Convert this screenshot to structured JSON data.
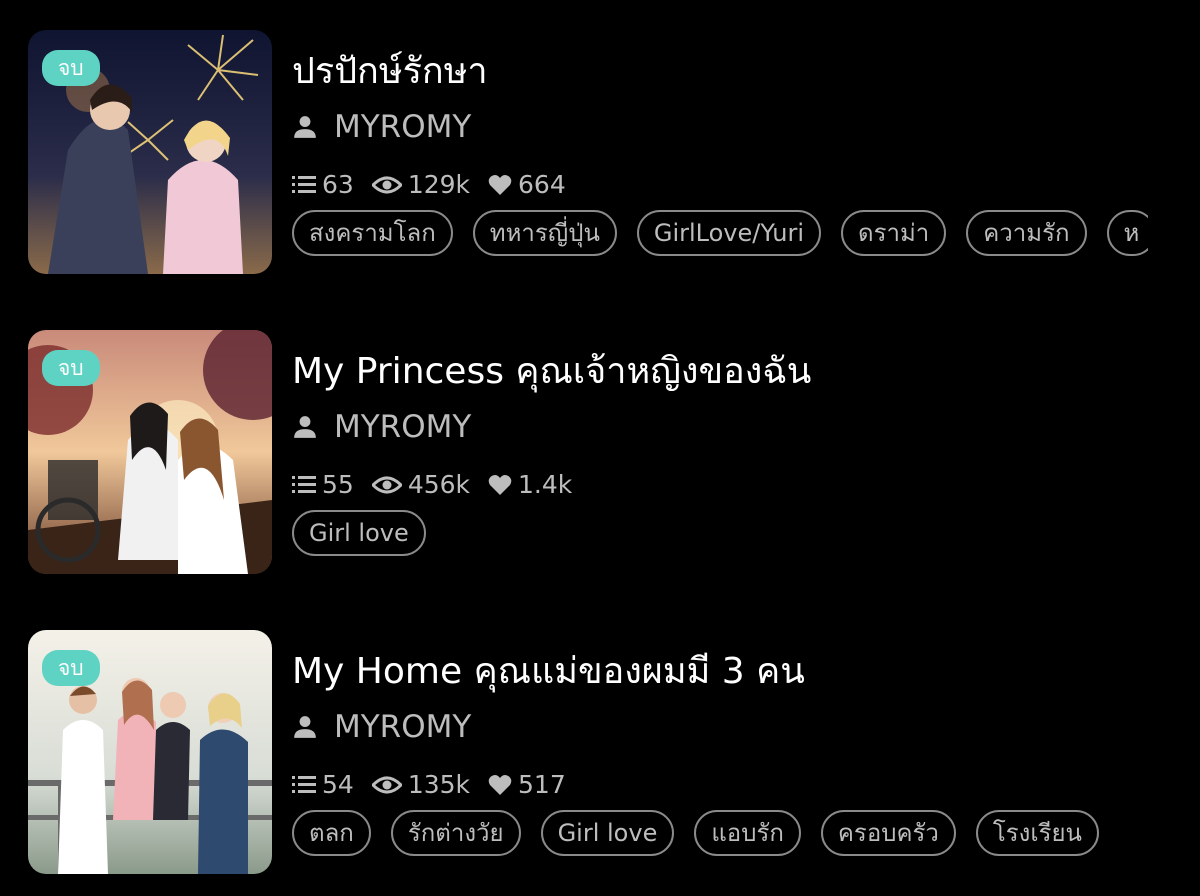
{
  "stories": [
    {
      "badge": "จบ",
      "title": "ปรปักษ์รักษา",
      "author": "MYROMY",
      "chapters": "63",
      "views": "129k",
      "likes": "664",
      "tags": [
        "สงครามโลก",
        "ทหารญี่ปุ่น",
        "GirlLove/Yuri",
        "ดราม่า",
        "ความรัก",
        "ห"
      ]
    },
    {
      "badge": "จบ",
      "title": "My Princess คุณเจ้าหญิงของฉัน",
      "author": "MYROMY",
      "chapters": "55",
      "views": "456k",
      "likes": "1.4k",
      "tags": [
        "Girl love"
      ]
    },
    {
      "badge": "จบ",
      "title": "My Home คุณแม่ของผมมี 3 คน",
      "author": "MYROMY",
      "chapters": "54",
      "views": "135k",
      "likes": "517",
      "tags": [
        "ตลก",
        "รักต่างวัย",
        "Girl love",
        "แอบรัก",
        "ครอบครัว",
        "โรงเรียน"
      ]
    }
  ],
  "colors": {
    "background": "#000000",
    "badge": "#5fd3c3",
    "muted_text": "#bdbdbd",
    "tag_border": "#8a8a8a"
  },
  "icons": {
    "author": "person-icon",
    "chapters": "list-icon",
    "views": "eye-icon",
    "likes": "heart-icon"
  }
}
